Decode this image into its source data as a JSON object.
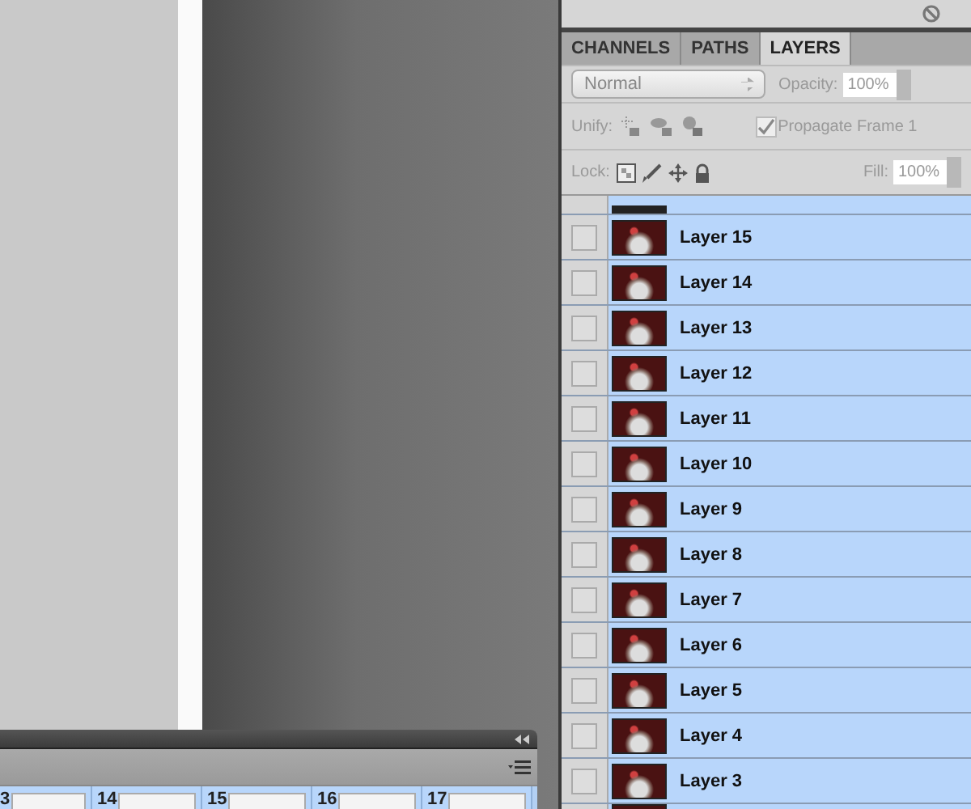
{
  "layers_panel": {
    "tabs": [
      {
        "label": "CHANNELS",
        "selected": false
      },
      {
        "label": "PATHS",
        "selected": false
      },
      {
        "label": "LAYERS",
        "selected": true
      }
    ],
    "blend_mode": "Normal",
    "opacity_label": "Opacity:",
    "opacity": "100%",
    "unify_label": "Unify:",
    "propagate": {
      "label": "Propagate Frame 1",
      "checked": true
    },
    "lock_label": "Lock:",
    "fill_label": "Fill:",
    "fill": "100%",
    "layers": [
      {
        "name": "Layer 15",
        "visible": false,
        "selected": true
      },
      {
        "name": "Layer 14",
        "visible": false,
        "selected": true
      },
      {
        "name": "Layer 13",
        "visible": false,
        "selected": true
      },
      {
        "name": "Layer 12",
        "visible": false,
        "selected": true
      },
      {
        "name": "Layer 11",
        "visible": false,
        "selected": true
      },
      {
        "name": "Layer 10",
        "visible": false,
        "selected": true
      },
      {
        "name": "Layer 9",
        "visible": false,
        "selected": true
      },
      {
        "name": "Layer 8",
        "visible": false,
        "selected": true
      },
      {
        "name": "Layer 7",
        "visible": false,
        "selected": true
      },
      {
        "name": "Layer 6",
        "visible": false,
        "selected": true
      },
      {
        "name": "Layer 5",
        "visible": false,
        "selected": true
      },
      {
        "name": "Layer 4",
        "visible": false,
        "selected": true
      },
      {
        "name": "Layer 3",
        "visible": false,
        "selected": true
      }
    ]
  },
  "animation_panel": {
    "frames": [
      {
        "number": "3",
        "selected": true
      },
      {
        "number": "14",
        "selected": true
      },
      {
        "number": "15",
        "selected": true
      },
      {
        "number": "16",
        "selected": true
      },
      {
        "number": "17",
        "selected": true
      }
    ]
  }
}
